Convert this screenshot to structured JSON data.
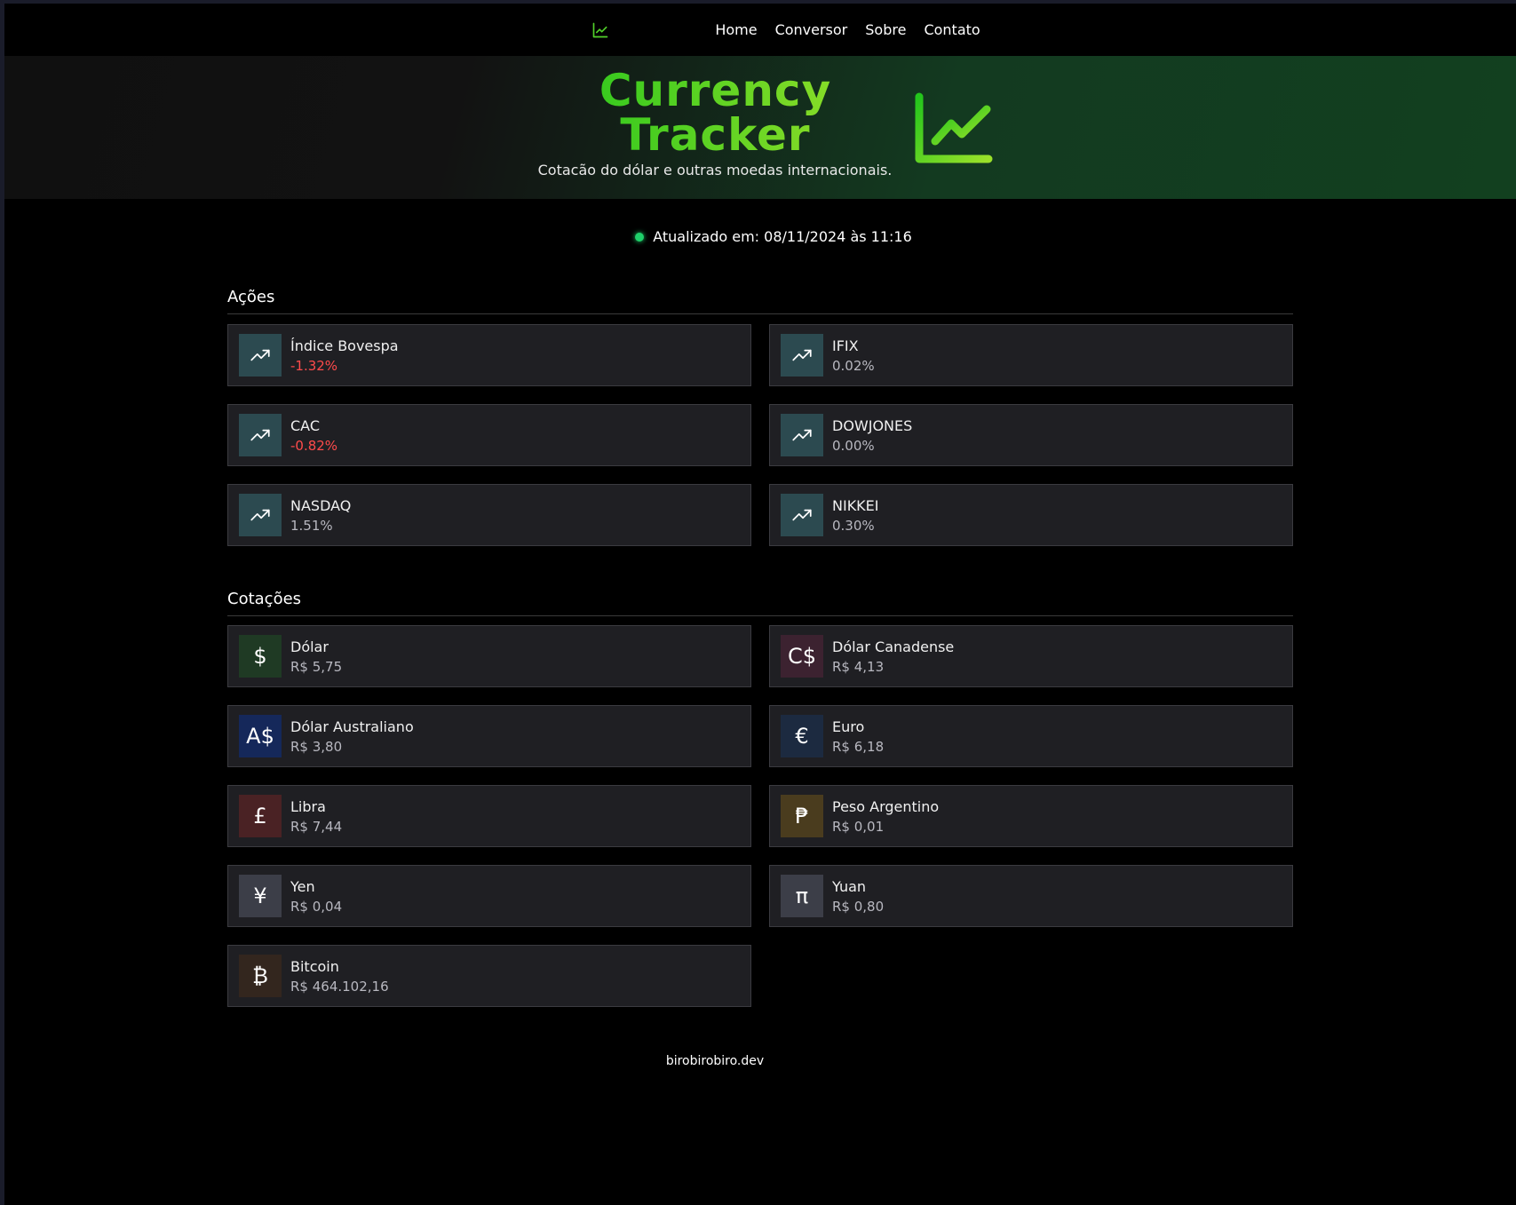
{
  "nav": {
    "links": [
      "Home",
      "Conversor",
      "Sobre",
      "Contato"
    ]
  },
  "hero": {
    "title_line1": "Currency",
    "title_line2": "Tracker",
    "subtitle": "Cotacão do dólar e outras moedas internacionais."
  },
  "status": {
    "text": "Atualizado em: 08/11/2024 às 11:16"
  },
  "acoes": {
    "title": "Ações",
    "items": [
      {
        "name": "Índice Bovespa",
        "value": "-1.32%",
        "negative": true
      },
      {
        "name": "IFIX",
        "value": "0.02%",
        "negative": false
      },
      {
        "name": "CAC",
        "value": "-0.82%",
        "negative": true
      },
      {
        "name": "DOWJONES",
        "value": "0.00%",
        "negative": false
      },
      {
        "name": "NASDAQ",
        "value": "1.51%",
        "negative": false
      },
      {
        "name": "NIKKEI",
        "value": "0.30%",
        "negative": false
      }
    ]
  },
  "cotacoes": {
    "title": "Cotações",
    "items": [
      {
        "name": "Dólar",
        "value": "R$ 5,75",
        "symbol": "$",
        "color": "#1f3a24"
      },
      {
        "name": "Dólar Canadense",
        "value": "R$ 4,13",
        "symbol": "C$",
        "color": "#3c2230"
      },
      {
        "name": "Dólar Australiano",
        "value": "R$ 3,80",
        "symbol": "A$",
        "color": "#15285a"
      },
      {
        "name": "Euro",
        "value": "R$ 6,18",
        "symbol": "€",
        "color": "#1c2a40"
      },
      {
        "name": "Libra",
        "value": "R$ 7,44",
        "symbol": "£",
        "color": "#4a2224"
      },
      {
        "name": "Peso Argentino",
        "value": "R$ 0,01",
        "symbol": "₱",
        "color": "#4a3c1e"
      },
      {
        "name": "Yen",
        "value": "R$ 0,04",
        "symbol": "¥",
        "color": "#3c3e48"
      },
      {
        "name": "Yuan",
        "value": "R$ 0,80",
        "symbol": "π",
        "color": "#3c3e48"
      },
      {
        "name": "Bitcoin",
        "value": "R$ 464.102,16",
        "symbol": "₿",
        "color": "#33261e"
      }
    ]
  },
  "footer": {
    "text": "birobirobiro.dev"
  },
  "colors": {
    "accent_green": "#33c41c",
    "negative": "#ff4b4b",
    "trend_icon_bg": "#2c4a50",
    "status_dot": "#1fd06a"
  }
}
